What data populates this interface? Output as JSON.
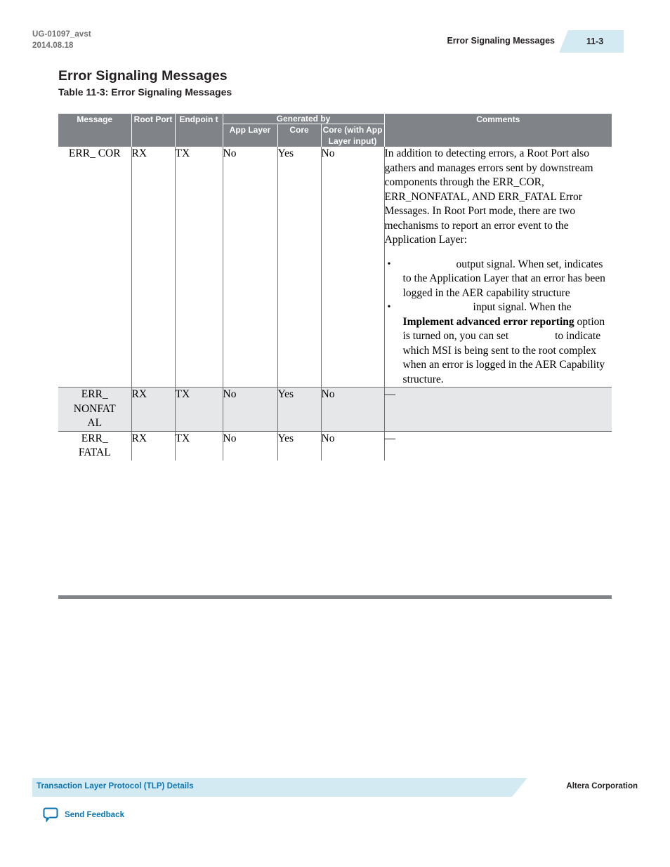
{
  "header": {
    "doc_id": "UG-01097_avst",
    "doc_date": "2014.08.18",
    "running_title": "Error Signaling Messages",
    "page_number": "11-3"
  },
  "section": {
    "title": "Error Signaling Messages",
    "table_caption": "Table 11-3: Error Signaling Messages"
  },
  "table": {
    "group_header": "Generated by",
    "columns": {
      "message": "Message",
      "root_port": "Root Port",
      "endpoint": "Endpoin t",
      "app_layer": "App Layer",
      "core": "Core",
      "core_with_app": "Core (with App Layer input)",
      "comments": "Comments"
    },
    "rows": [
      {
        "message": "ERR_ COR",
        "root_port": "RX",
        "endpoint": "TX",
        "app_layer": "No",
        "core": "Yes",
        "core_with_app": "No",
        "comments": {
          "intro": "In addition to detecting errors, a Root Port also gathers and manages errors sent by downstream components through the ERR_COR, ERR_NONFATAL, AND ERR_FATAL Error Messages. In Root Port mode, there are two mechanisms to report an error event to the Application Layer:",
          "bullets": [
            {
              "text_before_bold": "output signal. When set, indicates to the Application Layer that an error has been logged in the AER capability structure",
              "bold": "",
              "text_after_bold": ""
            },
            {
              "text_before_bold": "input signal. When the ",
              "bold": "Implement advanced error reporting",
              "text_after_bold": " option is turned on, you can set"
            }
          ],
          "bullet2_tail": "to indicate which MSI is being sent to the root complex when an error is logged in the AER Capability structure."
        }
      },
      {
        "message": "ERR_ NONFAT AL",
        "root_port": "RX",
        "endpoint": "TX",
        "app_layer": "No",
        "core": "Yes",
        "core_with_app": "No",
        "comments_dash": "—"
      },
      {
        "message": "ERR_ FATAL",
        "root_port": "RX",
        "endpoint": "TX",
        "app_layer": "No",
        "core": "Yes",
        "core_with_app": "No",
        "comments_dash": "—"
      }
    ]
  },
  "footer": {
    "breadcrumb": "Transaction Layer Protocol (TLP) Details",
    "corporation": "Altera Corporation",
    "feedback_label": "Send Feedback"
  },
  "colors": {
    "header_gray": "#808488",
    "row_alt_gray": "#e6e7e8",
    "accent_blue": "#0c75b1",
    "tag_blue": "#d3eaf2",
    "muted_text": "#6d6f71"
  }
}
